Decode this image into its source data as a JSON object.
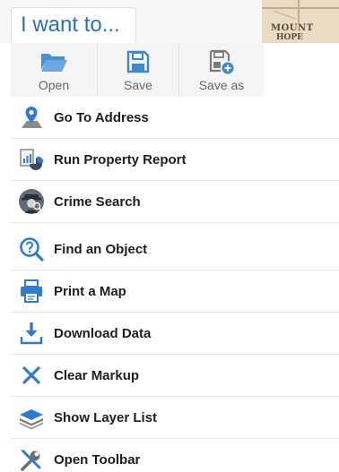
{
  "header": {
    "title": "I want to...",
    "map_label_line1": "MOUNT",
    "map_label_line2": "HOPE"
  },
  "toolbar": {
    "open_label": "Open",
    "save_label": "Save",
    "save_as_label": "Save as"
  },
  "menu": {
    "items": [
      {
        "label": "Go To Address",
        "icon": "map-pin-icon"
      },
      {
        "label": "Run Property Report",
        "icon": "property-report-icon"
      },
      {
        "label": "Crime Search",
        "icon": "detective-icon"
      },
      {
        "label": "Find an Object",
        "icon": "search-question-icon"
      },
      {
        "label": "Print a Map",
        "icon": "printer-icon"
      },
      {
        "label": "Download Data",
        "icon": "download-icon"
      },
      {
        "label": "Clear Markup",
        "icon": "close-x-icon"
      },
      {
        "label": "Show Layer List",
        "icon": "layers-icon"
      },
      {
        "label": "Open Toolbar",
        "icon": "tools-icon"
      }
    ]
  },
  "colors": {
    "accent_blue": "#2a72b8",
    "icon_blue": "#2e7bd1",
    "toolbar_bg": "#f4f4f4",
    "divider": "#e6e6e6"
  }
}
